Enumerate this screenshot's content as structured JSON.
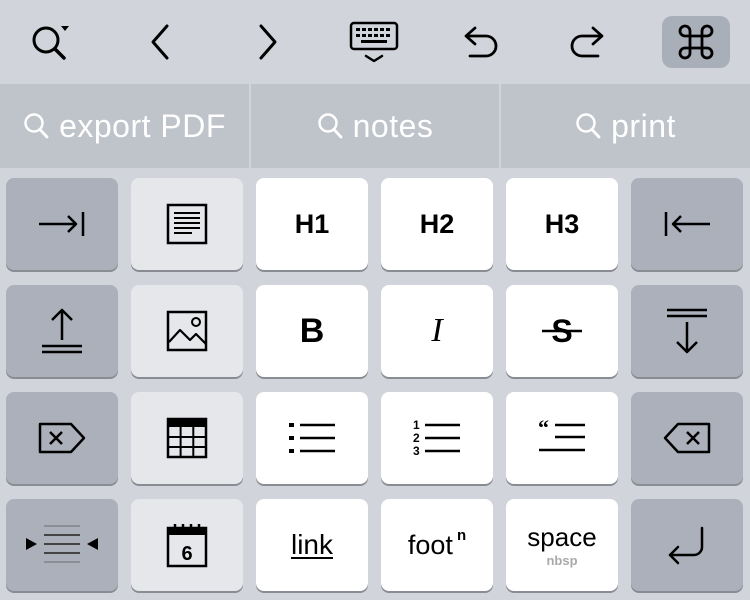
{
  "toolbar": {
    "buttons": [
      {
        "icon": "search-menu-icon"
      },
      {
        "icon": "chevron-left-icon"
      },
      {
        "icon": "chevron-right-icon"
      },
      {
        "icon": "keyboard-dismiss-icon"
      },
      {
        "icon": "undo-icon"
      },
      {
        "icon": "redo-icon"
      },
      {
        "icon": "command-icon",
        "active": true
      }
    ]
  },
  "suggestions": [
    "export PDF",
    "notes",
    "print"
  ],
  "keys": {
    "h1": "H1",
    "h2": "H2",
    "h3": "H3",
    "bold": "B",
    "italic": "I",
    "link": "link",
    "footnote": "foot",
    "footnote_sup": "n",
    "space": "space",
    "space_sub": "nbsp",
    "calendar_day": "6"
  },
  "colors": {
    "background": "#d1d4da",
    "suggestion_bar": "#bfc3ca",
    "key_white": "#ffffff",
    "key_light": "#e6e7eb",
    "key_dark": "#abb0ba",
    "active_toolbar": "#a9afb9"
  }
}
